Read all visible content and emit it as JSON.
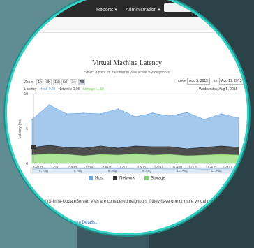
{
  "nav": {
    "items": [
      "Reports ▾",
      "Administration ▾"
    ]
  },
  "breadcrumb": "r",
  "chart_data": {
    "type": "area",
    "title": "Virtual Machine Latency",
    "subtitle": "Select a point on the chart to view active VM neighbors",
    "zoom": {
      "label": "Zoom",
      "buttons": [
        "1h",
        "8h",
        "1d",
        "5d",
        "1m",
        "All"
      ],
      "active": "All",
      "disabled": [
        "1m"
      ]
    },
    "range": {
      "from_label": "From",
      "from_value": "Aug 5, 2015",
      "to_label": "To",
      "to_value": "Aug 11, 2015"
    },
    "hover": {
      "label": "Latency",
      "host": "Host: 0.35",
      "network": "Network: 1.06",
      "storage": "Storage: 1.18",
      "date": "Wednesday, Aug 5, 2015"
    },
    "ylabel": "Latency (ms)",
    "ylim": [
      0,
      10
    ],
    "yticks": [
      "0",
      "5",
      "10"
    ],
    "xticks": [
      "6 Aug",
      "12:00",
      "7 Aug",
      "12:00",
      "8 Aug",
      "12:00",
      "9 Aug",
      "12:00",
      "10 Aug",
      "12:00",
      "11 Aug",
      "12:00"
    ],
    "x": [
      0,
      0.5,
      1,
      1.5,
      2,
      2.5,
      3,
      3.5,
      4,
      4.5,
      5,
      5.5,
      6
    ],
    "series": [
      {
        "name": "Host",
        "values": [
          4.0,
          5.8,
          4.8,
          5.0,
          4.6,
          5.6,
          4.2,
          4.8,
          4.4,
          5.2,
          4.0,
          4.6,
          4.2
        ]
      },
      {
        "name": "Network",
        "values": [
          1.1,
          1.2,
          1.0,
          1.1,
          1.2,
          1.0,
          1.1,
          1.2,
          1.1,
          1.0,
          1.1,
          1.2,
          1.1
        ]
      },
      {
        "name": "Storage",
        "values": [
          1.2,
          1.4,
          1.3,
          1.1,
          1.3,
          1.2,
          1.4,
          1.2,
          1.3,
          1.1,
          1.2,
          1.3,
          1.2
        ]
      }
    ],
    "navigator_ticks": [
      "6. Aug",
      "7. Aug",
      "8. Aug",
      "9. Aug",
      "10. Aug",
      "11. Aug"
    ],
    "legend": [
      {
        "name": "Host",
        "color": "#6fa7e0"
      },
      {
        "name": "Network",
        "color": "#333333"
      },
      {
        "name": "Storage",
        "color": "#7ccf6a"
      }
    ],
    "legend_position": "bottom"
  },
  "footer": {
    "paragraph": "ing VMs of IS-Infra-UpdateServer. VMs are considered neighbors if they have one or more virtual disks residing on the",
    "link": "Datastore Details..."
  }
}
